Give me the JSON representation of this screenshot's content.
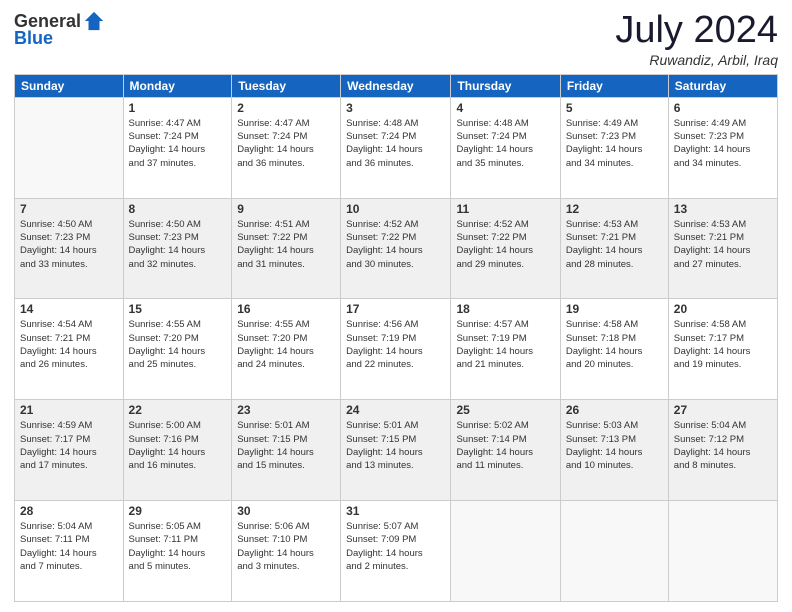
{
  "header": {
    "logo_general": "General",
    "logo_blue": "Blue",
    "month_year": "July 2024",
    "location": "Ruwandiz, Arbil, Iraq"
  },
  "weekdays": [
    "Sunday",
    "Monday",
    "Tuesday",
    "Wednesday",
    "Thursday",
    "Friday",
    "Saturday"
  ],
  "rows": [
    [
      {
        "day": "",
        "text": ""
      },
      {
        "day": "1",
        "text": "Sunrise: 4:47 AM\nSunset: 7:24 PM\nDaylight: 14 hours\nand 37 minutes."
      },
      {
        "day": "2",
        "text": "Sunrise: 4:47 AM\nSunset: 7:24 PM\nDaylight: 14 hours\nand 36 minutes."
      },
      {
        "day": "3",
        "text": "Sunrise: 4:48 AM\nSunset: 7:24 PM\nDaylight: 14 hours\nand 36 minutes."
      },
      {
        "day": "4",
        "text": "Sunrise: 4:48 AM\nSunset: 7:24 PM\nDaylight: 14 hours\nand 35 minutes."
      },
      {
        "day": "5",
        "text": "Sunrise: 4:49 AM\nSunset: 7:23 PM\nDaylight: 14 hours\nand 34 minutes."
      },
      {
        "day": "6",
        "text": "Sunrise: 4:49 AM\nSunset: 7:23 PM\nDaylight: 14 hours\nand 34 minutes."
      }
    ],
    [
      {
        "day": "7",
        "text": "Sunrise: 4:50 AM\nSunset: 7:23 PM\nDaylight: 14 hours\nand 33 minutes."
      },
      {
        "day": "8",
        "text": "Sunrise: 4:50 AM\nSunset: 7:23 PM\nDaylight: 14 hours\nand 32 minutes."
      },
      {
        "day": "9",
        "text": "Sunrise: 4:51 AM\nSunset: 7:22 PM\nDaylight: 14 hours\nand 31 minutes."
      },
      {
        "day": "10",
        "text": "Sunrise: 4:52 AM\nSunset: 7:22 PM\nDaylight: 14 hours\nand 30 minutes."
      },
      {
        "day": "11",
        "text": "Sunrise: 4:52 AM\nSunset: 7:22 PM\nDaylight: 14 hours\nand 29 minutes."
      },
      {
        "day": "12",
        "text": "Sunrise: 4:53 AM\nSunset: 7:21 PM\nDaylight: 14 hours\nand 28 minutes."
      },
      {
        "day": "13",
        "text": "Sunrise: 4:53 AM\nSunset: 7:21 PM\nDaylight: 14 hours\nand 27 minutes."
      }
    ],
    [
      {
        "day": "14",
        "text": "Sunrise: 4:54 AM\nSunset: 7:21 PM\nDaylight: 14 hours\nand 26 minutes."
      },
      {
        "day": "15",
        "text": "Sunrise: 4:55 AM\nSunset: 7:20 PM\nDaylight: 14 hours\nand 25 minutes."
      },
      {
        "day": "16",
        "text": "Sunrise: 4:55 AM\nSunset: 7:20 PM\nDaylight: 14 hours\nand 24 minutes."
      },
      {
        "day": "17",
        "text": "Sunrise: 4:56 AM\nSunset: 7:19 PM\nDaylight: 14 hours\nand 22 minutes."
      },
      {
        "day": "18",
        "text": "Sunrise: 4:57 AM\nSunset: 7:19 PM\nDaylight: 14 hours\nand 21 minutes."
      },
      {
        "day": "19",
        "text": "Sunrise: 4:58 AM\nSunset: 7:18 PM\nDaylight: 14 hours\nand 20 minutes."
      },
      {
        "day": "20",
        "text": "Sunrise: 4:58 AM\nSunset: 7:17 PM\nDaylight: 14 hours\nand 19 minutes."
      }
    ],
    [
      {
        "day": "21",
        "text": "Sunrise: 4:59 AM\nSunset: 7:17 PM\nDaylight: 14 hours\nand 17 minutes."
      },
      {
        "day": "22",
        "text": "Sunrise: 5:00 AM\nSunset: 7:16 PM\nDaylight: 14 hours\nand 16 minutes."
      },
      {
        "day": "23",
        "text": "Sunrise: 5:01 AM\nSunset: 7:15 PM\nDaylight: 14 hours\nand 15 minutes."
      },
      {
        "day": "24",
        "text": "Sunrise: 5:01 AM\nSunset: 7:15 PM\nDaylight: 14 hours\nand 13 minutes."
      },
      {
        "day": "25",
        "text": "Sunrise: 5:02 AM\nSunset: 7:14 PM\nDaylight: 14 hours\nand 11 minutes."
      },
      {
        "day": "26",
        "text": "Sunrise: 5:03 AM\nSunset: 7:13 PM\nDaylight: 14 hours\nand 10 minutes."
      },
      {
        "day": "27",
        "text": "Sunrise: 5:04 AM\nSunset: 7:12 PM\nDaylight: 14 hours\nand 8 minutes."
      }
    ],
    [
      {
        "day": "28",
        "text": "Sunrise: 5:04 AM\nSunset: 7:11 PM\nDaylight: 14 hours\nand 7 minutes."
      },
      {
        "day": "29",
        "text": "Sunrise: 5:05 AM\nSunset: 7:11 PM\nDaylight: 14 hours\nand 5 minutes."
      },
      {
        "day": "30",
        "text": "Sunrise: 5:06 AM\nSunset: 7:10 PM\nDaylight: 14 hours\nand 3 minutes."
      },
      {
        "day": "31",
        "text": "Sunrise: 5:07 AM\nSunset: 7:09 PM\nDaylight: 14 hours\nand 2 minutes."
      },
      {
        "day": "",
        "text": ""
      },
      {
        "day": "",
        "text": ""
      },
      {
        "day": "",
        "text": ""
      }
    ]
  ]
}
